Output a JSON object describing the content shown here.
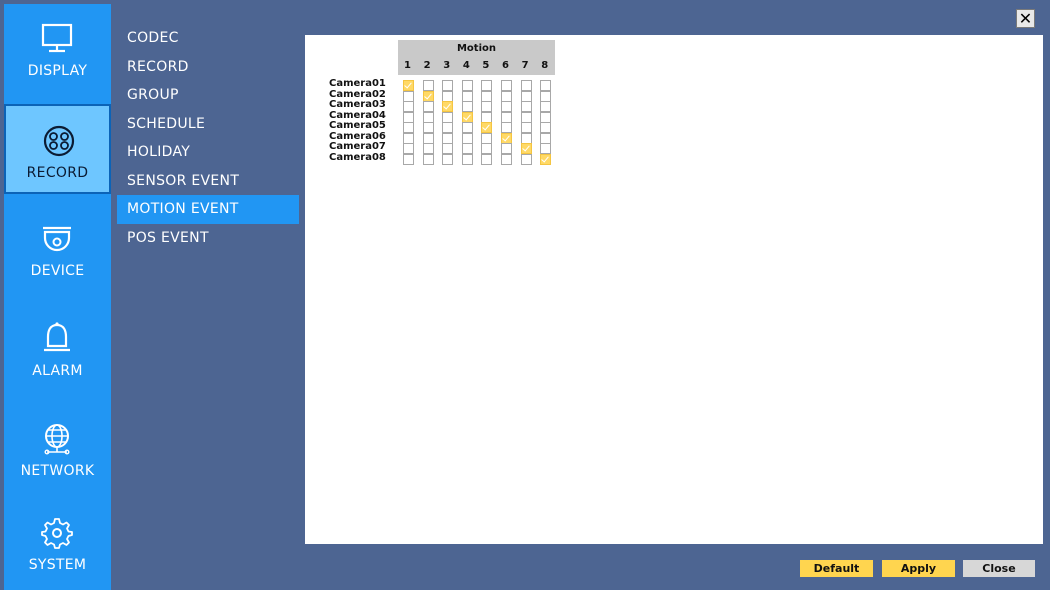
{
  "rail": {
    "items": [
      {
        "label": "DISPLAY",
        "icon": "monitor-icon"
      },
      {
        "label": "RECORD",
        "icon": "film-reel-icon",
        "active": true
      },
      {
        "label": "DEVICE",
        "icon": "dome-camera-icon"
      },
      {
        "label": "ALARM",
        "icon": "bell-icon"
      },
      {
        "label": "NETWORK",
        "icon": "globe-icon"
      },
      {
        "label": "SYSTEM",
        "icon": "gear-icon"
      }
    ]
  },
  "submenu": {
    "items": [
      {
        "label": "CODEC"
      },
      {
        "label": "RECORD"
      },
      {
        "label": "GROUP"
      },
      {
        "label": "SCHEDULE"
      },
      {
        "label": "HOLIDAY"
      },
      {
        "label": "SENSOR EVENT"
      },
      {
        "label": "MOTION EVENT",
        "active": true
      },
      {
        "label": "POS EVENT"
      }
    ]
  },
  "motion": {
    "header": "Motion",
    "columns": [
      "1",
      "2",
      "3",
      "4",
      "5",
      "6",
      "7",
      "8"
    ],
    "cameras": [
      "Camera01",
      "Camera02",
      "Camera03",
      "Camera04",
      "Camera05",
      "Camera06",
      "Camera07",
      "Camera08"
    ],
    "checked": [
      [
        true,
        false,
        false,
        false,
        false,
        false,
        false,
        false
      ],
      [
        false,
        true,
        false,
        false,
        false,
        false,
        false,
        false
      ],
      [
        false,
        false,
        true,
        false,
        false,
        false,
        false,
        false
      ],
      [
        false,
        false,
        false,
        true,
        false,
        false,
        false,
        false
      ],
      [
        false,
        false,
        false,
        false,
        true,
        false,
        false,
        false
      ],
      [
        false,
        false,
        false,
        false,
        false,
        true,
        false,
        false
      ],
      [
        false,
        false,
        false,
        false,
        false,
        false,
        true,
        false
      ],
      [
        false,
        false,
        false,
        false,
        false,
        false,
        false,
        true
      ]
    ]
  },
  "buttons": {
    "default_label": "Default",
    "apply_label": "Apply",
    "close_label": "Close",
    "close_x": "✕"
  },
  "colors": {
    "background": "#4d6592",
    "rail": "#2196f3",
    "rail_active": "#6ec6ff",
    "check_on": "#ffd966",
    "button_yellow": "#ffd54f"
  }
}
